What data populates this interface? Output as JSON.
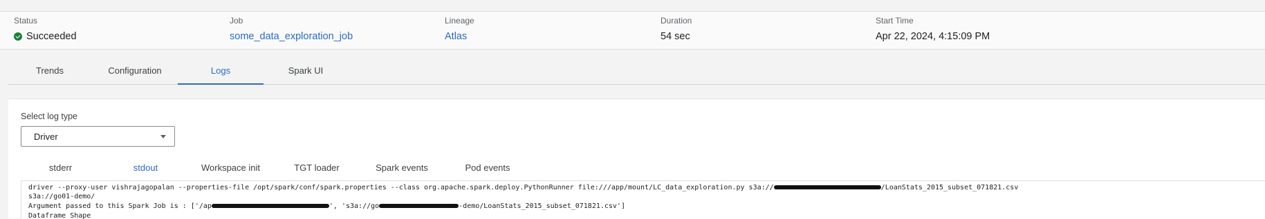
{
  "summary": {
    "status": {
      "label": "Status",
      "value": "Succeeded",
      "icon": "check-circle-icon",
      "color": "#188038"
    },
    "job": {
      "label": "Job",
      "value": "some_data_exploration_job"
    },
    "lineage": {
      "label": "Lineage",
      "value": "Atlas"
    },
    "duration": {
      "label": "Duration",
      "value": "54 sec"
    },
    "start_time": {
      "label": "Start Time",
      "value": "Apr 22, 2024, 4:15:09 PM"
    }
  },
  "top_tabs": [
    {
      "label": "Trends"
    },
    {
      "label": "Configuration"
    },
    {
      "label": "Logs",
      "active": true
    },
    {
      "label": "Spark UI"
    }
  ],
  "log_type": {
    "label": "Select log type",
    "selected": "Driver"
  },
  "sub_tabs": [
    {
      "label": "stderr"
    },
    {
      "label": "stdout",
      "active": true
    },
    {
      "label": "Workspace init"
    },
    {
      "label": "TGT loader"
    },
    {
      "label": "Spark events"
    },
    {
      "label": "Pod events"
    }
  ],
  "console": {
    "line1_a": "driver --proxy-user vishrajagopalan --properties-file /opt/spark/conf/spark.properties --class org.apache.spark.deploy.PythonRunner file:///app/mount/LC_data_exploration.py s3a://",
    "line1_b": "/LoanStats_2015_subset_071821.csv",
    "line2": "s3a://go01-demo/",
    "line3_a": "Argument passed to this Spark Job is : ['/ap",
    "line3_b": "', 's3a://go",
    "line3_c": "-demo/LoanStats_2015_subset_071821.csv']",
    "line4": "Dataframe Shape"
  },
  "colors": {
    "accent": "#2a6bc4",
    "success": "#188038"
  }
}
